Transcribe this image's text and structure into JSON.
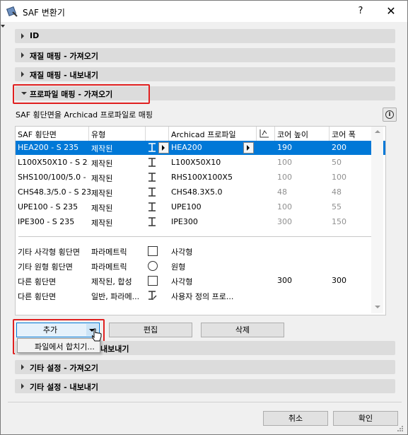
{
  "window": {
    "title": "SAF 변환기",
    "help": "?",
    "close": "✕"
  },
  "sections": {
    "id": "ID",
    "material_import": "재질 매핑 - 가져오기",
    "material_export": "재질 매핑 - 내보내기",
    "profile_import": "프로파일 매핑 - 가져오기",
    "profile_export_hidden": "내보내기",
    "other_import": "기타 설정 - 가져오기",
    "other_export": "기타 설정 - 내보내기"
  },
  "profile": {
    "subtitle": "SAF 횡단면을 Archicad 프로파일로 매핑",
    "headers": {
      "saf": "SAF 횡단면",
      "type": "유형",
      "archicad": "Archicad 프로파일",
      "core_height": "코어 높이",
      "core_width": "코어 폭"
    },
    "rows": [
      {
        "saf": "HEA200 - S 235",
        "type": "제작된",
        "profile": "HEA200",
        "h": "190",
        "w": "200"
      },
      {
        "saf": "L100X50X10 - S 2...",
        "type": "제작된",
        "profile": "L100X50X10",
        "h": "100",
        "w": "50"
      },
      {
        "saf": "SHS100/100/5.0 - ...",
        "type": "제작된",
        "profile": "RHS100X100X5",
        "h": "100",
        "w": "100"
      },
      {
        "saf": "CHS48.3/5.0 - S 235",
        "type": "제작된",
        "profile": "CHS48.3X5.0",
        "h": "48",
        "w": "48"
      },
      {
        "saf": "UPE100 - S 235",
        "type": "제작된",
        "profile": "UPE100",
        "h": "100",
        "w": "55"
      },
      {
        "saf": "IPE300 - S 235",
        "type": "제작된",
        "profile": "IPE300",
        "h": "300",
        "w": "150"
      }
    ],
    "other_rows": [
      {
        "saf": "기타 사각형 횡단면",
        "type": "파라메트릭",
        "profile": "사각형",
        "h": "",
        "w": ""
      },
      {
        "saf": "기타 원형 횡단면",
        "type": "파라메트릭",
        "profile": "원형",
        "h": "",
        "w": ""
      },
      {
        "saf": "다른 횡단면",
        "type": "제작된, 합성",
        "profile": "사각형",
        "h": "300",
        "w": "300"
      },
      {
        "saf": "다른 횡단면",
        "type": "일반, 파라메...",
        "profile": "사용자 정의 프로...",
        "h": "",
        "w": ""
      }
    ],
    "buttons": {
      "add": "추가",
      "edit": "편집",
      "delete": "삭제"
    },
    "add_menu": {
      "item": "파일에서 합치기..."
    }
  },
  "footer": {
    "cancel": "취소",
    "ok": "확인"
  },
  "colors": {
    "selection": "#0078d7",
    "highlight": "#e02020"
  }
}
